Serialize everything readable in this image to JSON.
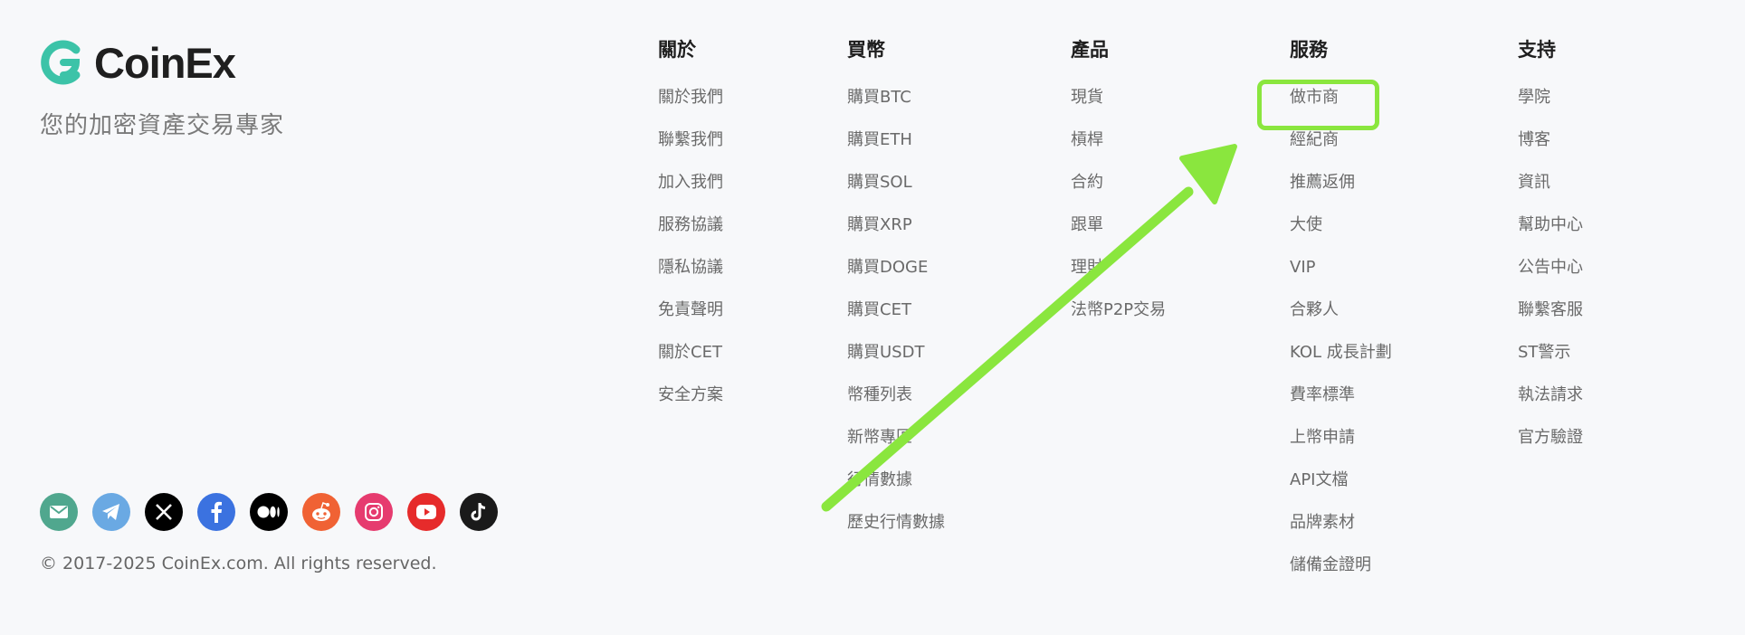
{
  "brand": {
    "name": "CoinEx",
    "tagline": "您的加密資產交易專家",
    "mark_color": "#3cc3a8"
  },
  "socials": [
    {
      "icon": "mail-icon",
      "color": "#50a78e"
    },
    {
      "icon": "telegram-icon",
      "color": "#6aa9e3"
    },
    {
      "icon": "x-icon",
      "color": "#000000"
    },
    {
      "icon": "facebook-icon",
      "color": "#3b72e0"
    },
    {
      "icon": "medium-icon",
      "color": "#000000"
    },
    {
      "icon": "reddit-icon",
      "color": "#f06234"
    },
    {
      "icon": "instagram-icon",
      "color": "#e63b6f"
    },
    {
      "icon": "youtube-icon",
      "color": "#e62b2b"
    },
    {
      "icon": "tiktok-icon",
      "color": "#1a1a1a"
    }
  ],
  "copyright": "© 2017-2025 CoinEx.com. All rights reserved.",
  "columns": [
    {
      "title": "關於",
      "items": [
        "關於我們",
        "聯繫我們",
        "加入我們",
        "服務協議",
        "隱私協議",
        "免責聲明",
        "關於CET",
        "安全方案"
      ]
    },
    {
      "title": "買幣",
      "items": [
        "購買BTC",
        "購買ETH",
        "購買SOL",
        "購買XRP",
        "購買DOGE",
        "購買CET",
        "購買USDT",
        "幣種列表",
        "新幣專區",
        "行情數據",
        "歷史行情數據"
      ]
    },
    {
      "title": "產品",
      "items": [
        "現貨",
        "槓桿",
        "合約",
        "跟單",
        "理財",
        "法幣P2P交易"
      ]
    },
    {
      "title": "服務",
      "items": [
        "做市商",
        "經紀商",
        "推薦返佣",
        "大使",
        "VIP",
        "合夥人",
        "KOL 成長計劃",
        "費率標準",
        "上幣申請",
        "API文檔",
        "品牌素材",
        "儲備金證明"
      ]
    },
    {
      "title": "支持",
      "items": [
        "學院",
        "博客",
        "資訊",
        "幫助中心",
        "公告中心",
        "聯繫客服",
        "ST警示",
        "執法請求",
        "官方驗證"
      ]
    }
  ],
  "annotation": {
    "highlight_color": "#8ae63e",
    "highlighted_item": "做市商"
  }
}
